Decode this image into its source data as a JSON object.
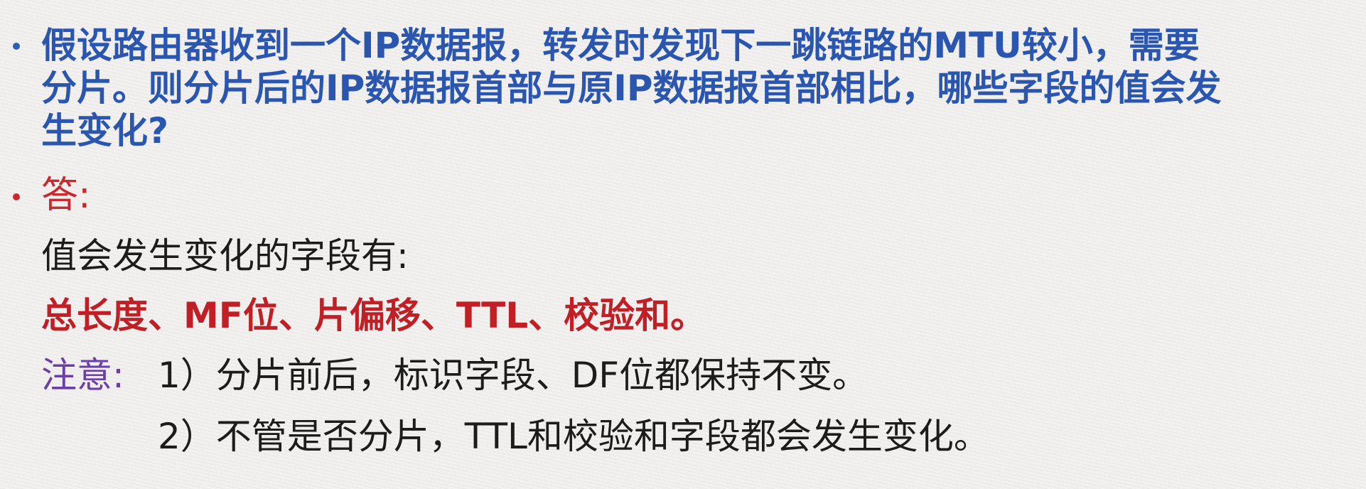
{
  "question": {
    "lines": [
      "假设路由器收到一个IP数据报，转发时发现下一跳链路的MTU较小，需要",
      "分片。则分片后的IP数据报首部与原IP数据报首部相比，哪些字段的值会发",
      "生变化?"
    ]
  },
  "answer": {
    "label": "答:",
    "intro": "值会发生变化的字段有:",
    "fields": "总长度、MF位、片偏移、TTL、校验和。"
  },
  "note": {
    "label": "注意:",
    "items": [
      "1）分片前后，标识字段、DF位都保持不变。",
      "2）不管是否分片，TTL和校验和字段都会发生变化。"
    ]
  },
  "colors": {
    "question": "#2a56b0",
    "answer_label": "#c62a2f",
    "fields": "#c01f26",
    "note_label": "#6a3fa6",
    "body_text": "#1c1c1c",
    "background": "#f3f2f0"
  }
}
